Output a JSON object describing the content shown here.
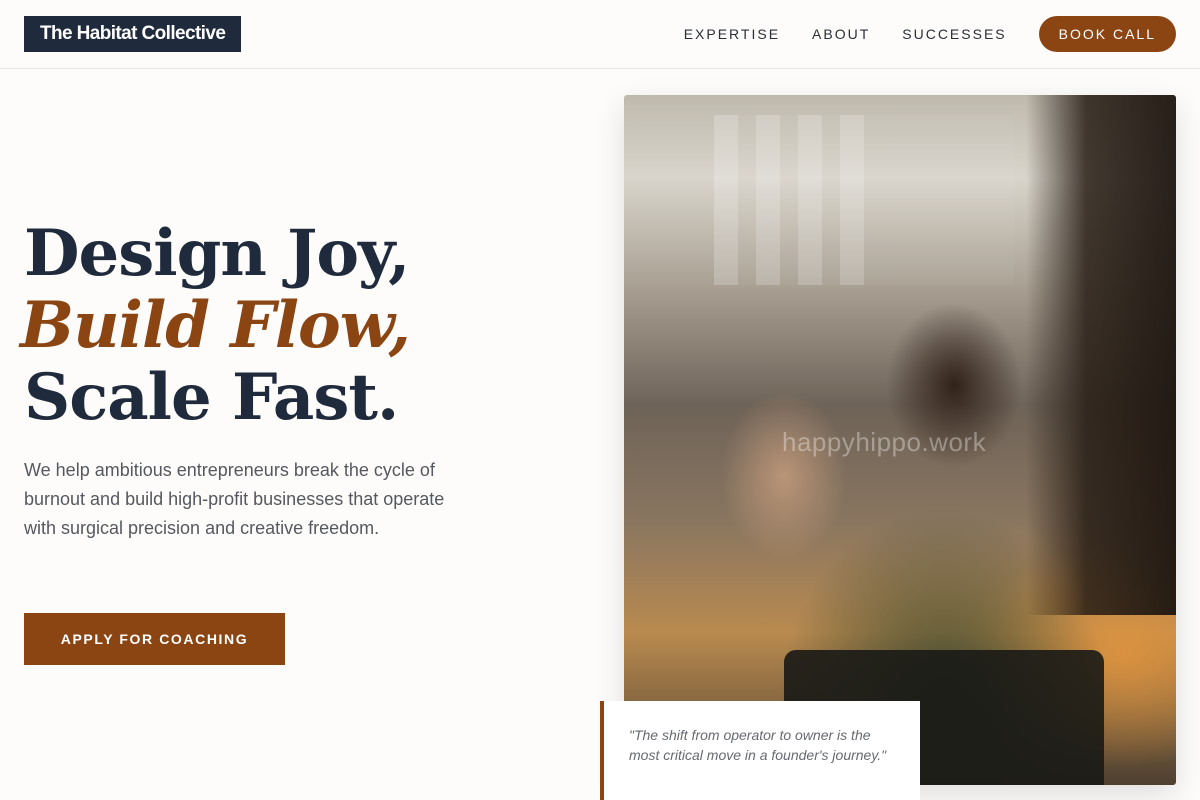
{
  "brand": {
    "name": "The Habitat Collective"
  },
  "nav": {
    "links": [
      "EXPERTISE",
      "ABOUT",
      "SUCCESSES"
    ],
    "cta_label": "BOOK CALL"
  },
  "hero": {
    "headline_line1": "Design Joy,",
    "headline_line2": "Build Flow,",
    "headline_line3": "Scale Fast.",
    "description": "We help ambitious entrepreneurs break the cycle of burnout and build high-profit businesses that operate with surgical precision and creative freedom.",
    "cta_label": "APPLY FOR COACHING"
  },
  "image": {
    "watermark": "happyhippo.work"
  },
  "quote": {
    "text": "\"The shift from operator to owner is the most critical move in a founder's journey.\""
  },
  "colors": {
    "navy": "#1f2a3c",
    "accent": "#8b4513",
    "background": "#fdfcfa"
  }
}
